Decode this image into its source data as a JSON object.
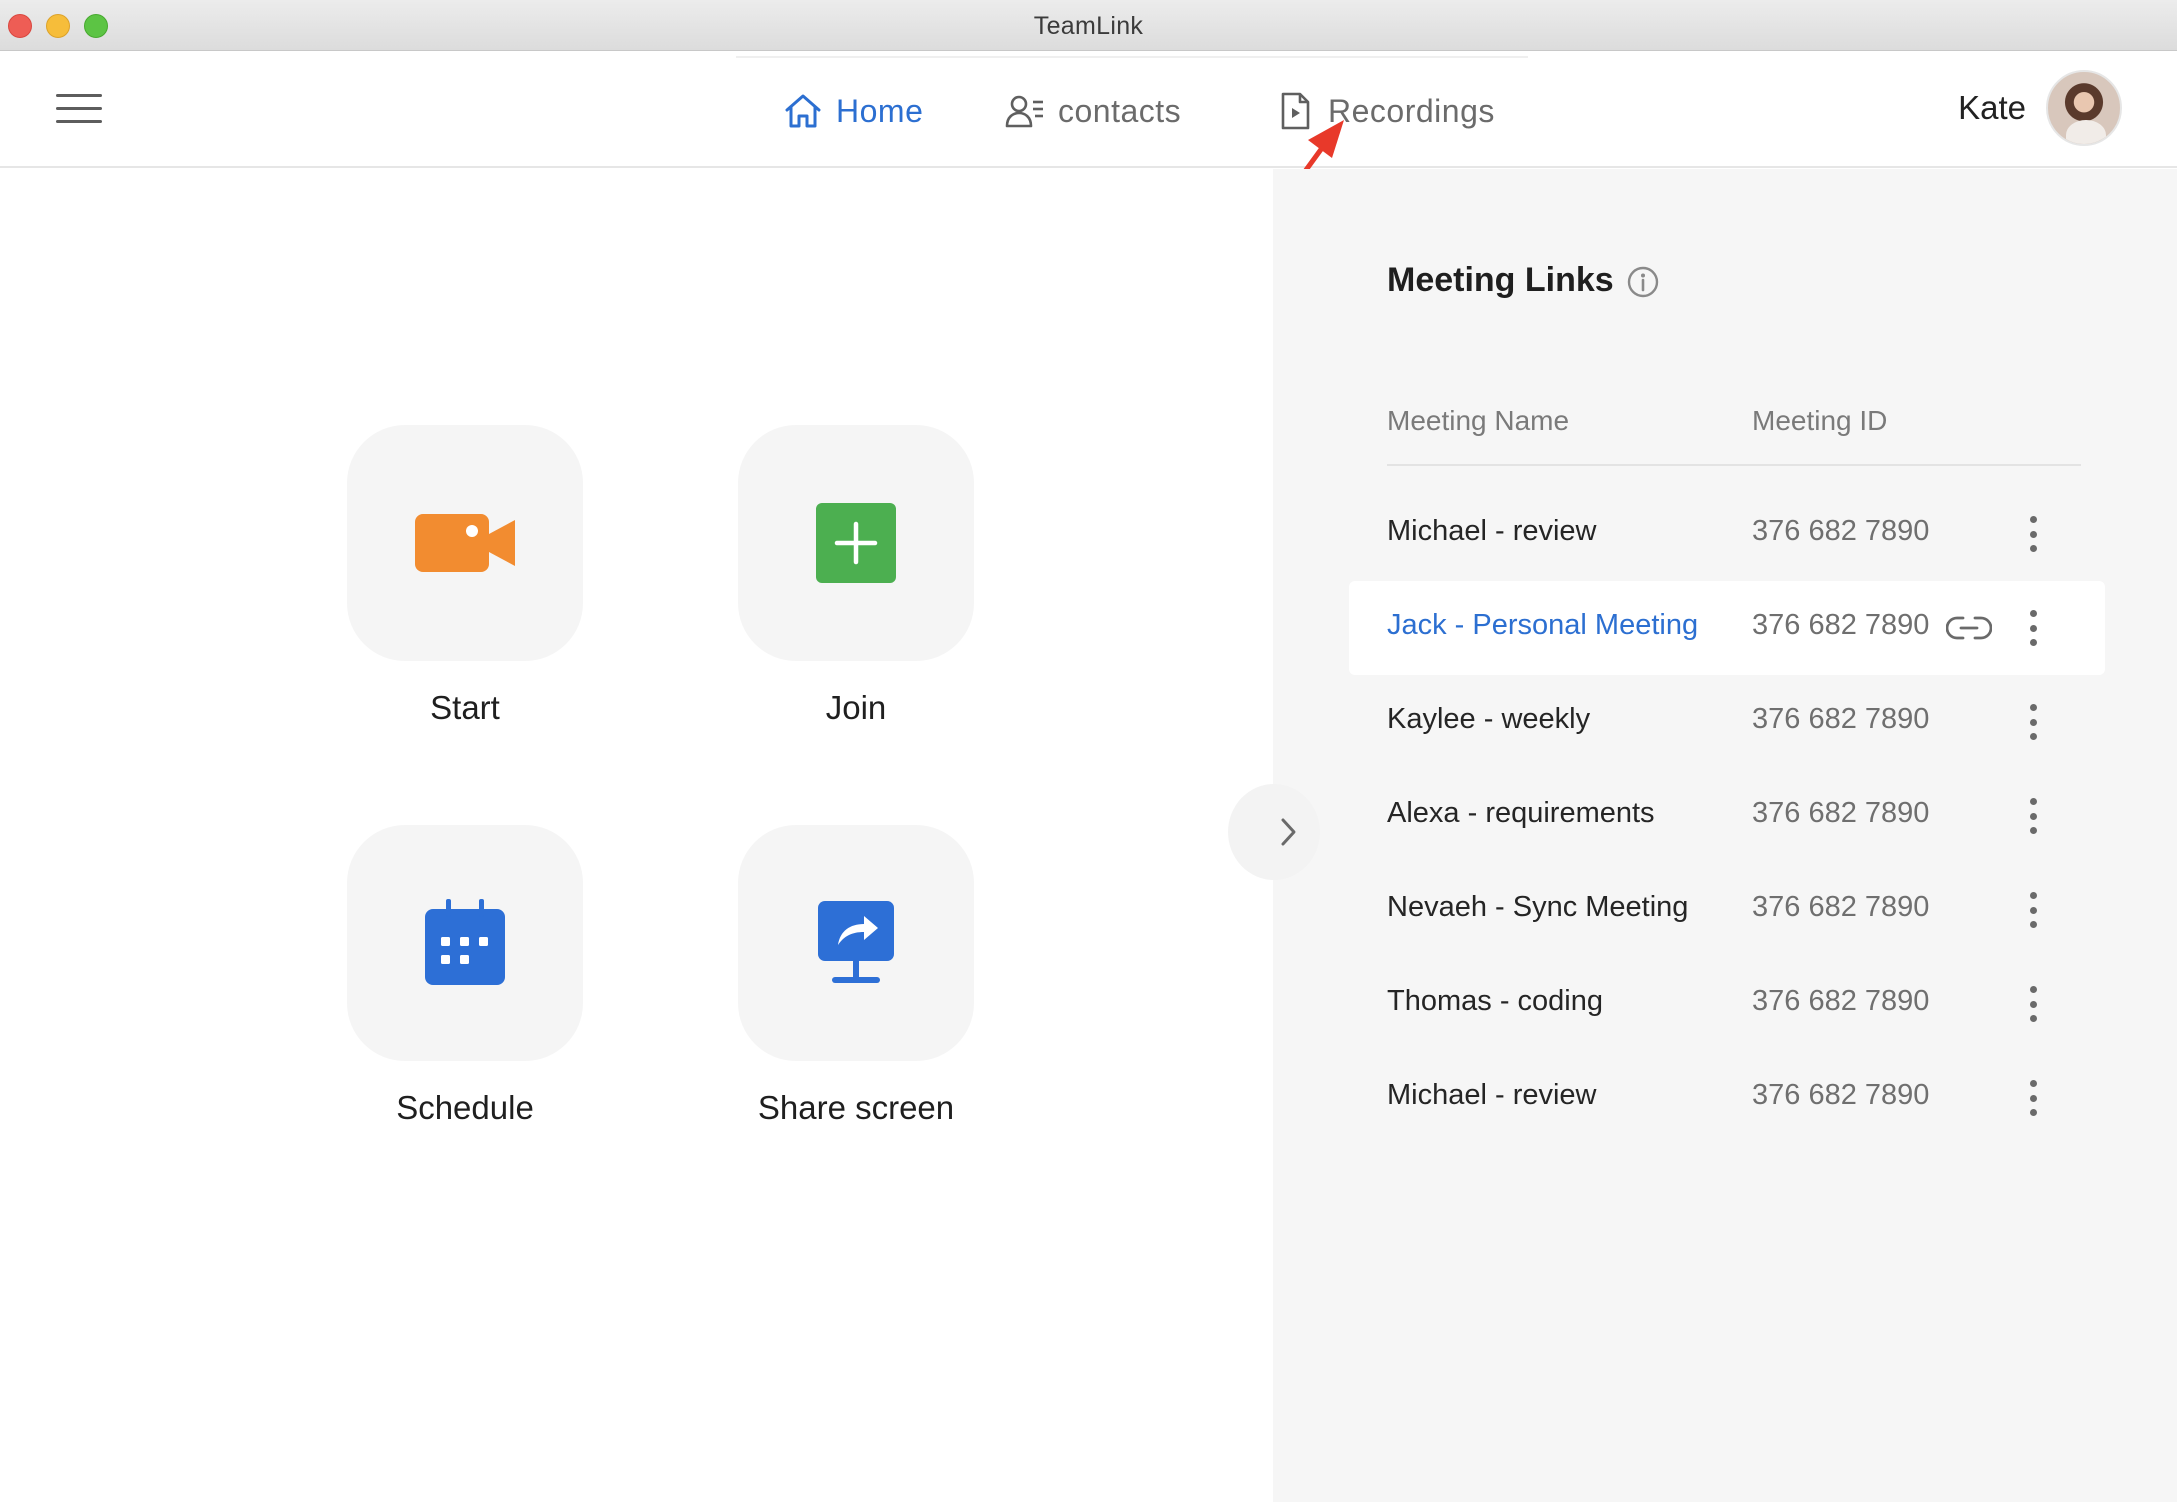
{
  "window": {
    "title": "TeamLink"
  },
  "nav": {
    "home": "Home",
    "contacts": "contacts",
    "recordings": "Recordings"
  },
  "user": {
    "name": "Kate"
  },
  "actions": {
    "start": "Start",
    "join": "Join",
    "schedule": "Schedule",
    "share": "Share screen"
  },
  "colors": {
    "accent": "#2c6fd1",
    "start_orange": "#f28c30",
    "join_green": "#4caf50",
    "schedule_blue": "#2d6fd6",
    "annotation_red": "#e8392a"
  },
  "meeting_links": {
    "title": "Meeting Links",
    "columns": {
      "name": "Meeting Name",
      "id": "Meeting ID"
    },
    "rows": [
      {
        "name": "Michael - review",
        "id": "376 682 7890"
      },
      {
        "name": "Jack - Personal Meeting",
        "id": "376 682 7890"
      },
      {
        "name": "Kaylee - weekly",
        "id": "376 682 7890"
      },
      {
        "name": "Alexa - requirements",
        "id": "376 682 7890"
      },
      {
        "name": "Nevaeh - Sync Meeting",
        "id": "376 682 7890"
      },
      {
        "name": "Thomas - coding",
        "id": "376 682 7890"
      },
      {
        "name": "Michael - review",
        "id": "376 682 7890"
      }
    ]
  }
}
